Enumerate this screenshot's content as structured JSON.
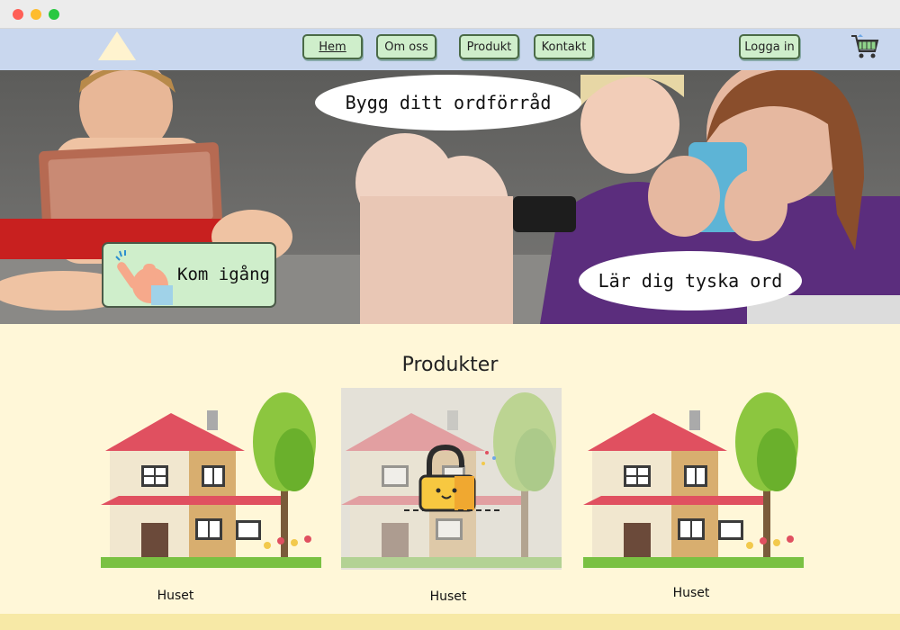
{
  "nav": {
    "home": "Hem",
    "about": "Om oss",
    "product": "Produkt",
    "contact": "Kontakt",
    "login": "Logga in"
  },
  "hero": {
    "bubble_top": "Bygg ditt ordförråd",
    "bubble_bottom": "Lär dig tyska ord",
    "cta": "Kom igång"
  },
  "products": {
    "title": "Produkter",
    "items": [
      {
        "caption": "Huset",
        "locked": false
      },
      {
        "caption": "Huset",
        "locked": true
      },
      {
        "caption": "Huset",
        "locked": false
      }
    ]
  },
  "icons": [
    "logo-triangle-icon",
    "cart-icon",
    "pointing-hand-icon",
    "padlock-icon"
  ]
}
